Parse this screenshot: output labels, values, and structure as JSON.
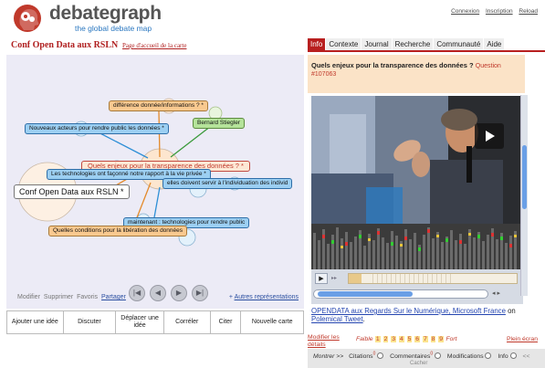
{
  "header": {
    "logo_name": "debategraph",
    "logo_tagline": "the global debate map",
    "links": [
      "Connexion",
      "Inscription",
      "Reload"
    ]
  },
  "map": {
    "title": "Conf Open Data aux RSLN",
    "home_link": "Page d'accueil de la carte",
    "nodes": {
      "diff_info": "différence donnée/informations ? *",
      "stiegler": "Bernard Stiegler",
      "nouveaux_acteurs": "Nouveaux acteurs pour rendre public les données *",
      "main_question": "Quels enjeux pour la transparence des données ? *",
      "technologies": "Les technologies ont façonné notre rapport à la vie privée *",
      "individuation": "elles doivent servir à l'individuation des individ",
      "root": "Conf Open Data aux RSLN *",
      "maintenant": "maintenant : technologies pour rendre public",
      "conditions": "Quelles conditions pour la libération des données"
    },
    "actions": [
      "Modifier",
      "Supprimer",
      "Favoris"
    ],
    "share_label": "Partager",
    "other_views": "Autres représentations",
    "colors": {
      "blue_node": "#9ccff2",
      "orange_node": "#f9c98f",
      "green_node": "#b5e39a",
      "main_border": "#c24a40"
    }
  },
  "toolbar": {
    "add_idea": "Ajouter une idée",
    "discuss": "Discuter",
    "move_idea": "Déplacer une idée",
    "correlate": "Corréler",
    "cite": "Citer",
    "new_map": "Nouvelle carte"
  },
  "tabs": {
    "items": [
      "Info",
      "Contexte",
      "Journal",
      "Recherche",
      "Communauté",
      "Aide"
    ],
    "active": "Info"
  },
  "question": {
    "title": "Quels enjeux pour la transparence des données ?",
    "type": "Question",
    "id": "#107063"
  },
  "document": {
    "title": "OPENDATA aux Regards Sur le Numérique, Microsoft France",
    "connector": "on",
    "source": "Polemical Tweet",
    "end": "."
  },
  "rating": {
    "edit_details": "Modifier les détails",
    "low": "Faible",
    "values": [
      "1",
      "2",
      "3",
      "4",
      "5",
      "6",
      "7",
      "8",
      "9"
    ],
    "high": "Fort",
    "fullscreen": "Plein écran"
  },
  "filters": {
    "show_more": "Montrer >>",
    "citations": "Citations",
    "citations_count": "0",
    "comments": "Commentaires",
    "comments_count": "0",
    "modifications": "Modifications",
    "info": "Info",
    "back": "<<",
    "hide": "Cacher"
  }
}
